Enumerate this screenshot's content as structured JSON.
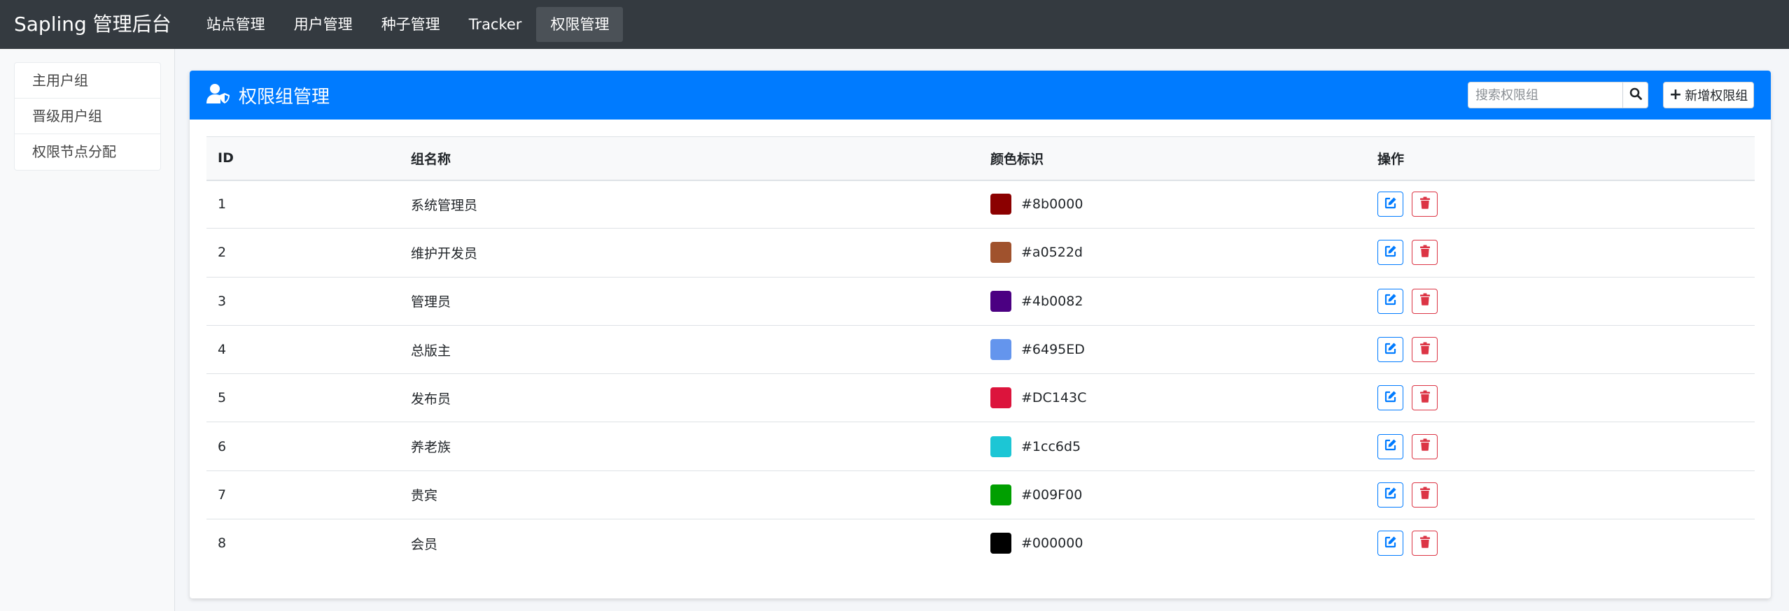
{
  "navbar": {
    "brand": "Sapling 管理后台",
    "items": [
      "站点管理",
      "用户管理",
      "种子管理",
      "Tracker",
      "权限管理"
    ],
    "active_index": 4
  },
  "sidebar": {
    "items": [
      "主用户组",
      "晋级用户组",
      "权限节点分配"
    ]
  },
  "card": {
    "title": "权限组管理",
    "title_icon": "user-shield-icon",
    "search_placeholder": "搜索权限组",
    "add_label": "新增权限组"
  },
  "table": {
    "headers": [
      "ID",
      "组名称",
      "颜色标识",
      "操作"
    ],
    "rows": [
      {
        "id": "1",
        "name": "系统管理员",
        "color": "#8b0000"
      },
      {
        "id": "2",
        "name": "维护开发员",
        "color": "#a0522d"
      },
      {
        "id": "3",
        "name": "管理员",
        "color": "#4b0082"
      },
      {
        "id": "4",
        "name": "总版主",
        "color": "#6495ED"
      },
      {
        "id": "5",
        "name": "发布员",
        "color": "#DC143C"
      },
      {
        "id": "6",
        "name": "养老族",
        "color": "#1cc6d5"
      },
      {
        "id": "7",
        "name": "贵宾",
        "color": "#009F00"
      },
      {
        "id": "8",
        "name": "会员",
        "color": "#000000"
      }
    ]
  },
  "colors": {
    "navbar": "#343a40",
    "primary": "#007bff",
    "danger": "#dc3545"
  }
}
